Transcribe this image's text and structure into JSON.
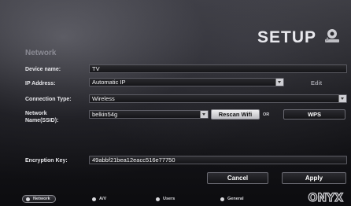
{
  "header": {
    "title": "SETUP",
    "icon": "settings-wrench-icon"
  },
  "section": {
    "title": "Network"
  },
  "form": {
    "device_name": {
      "label": "Device name:",
      "value": "TV"
    },
    "ip_address": {
      "label": "IP Address:",
      "value": "Automatic IP",
      "edit_label": "Edit"
    },
    "connection_type": {
      "label": "Connection Type:",
      "value": "Wireless"
    },
    "ssid": {
      "label": "Network\nName(SSID):",
      "value": "belkin54g",
      "rescan_label": "Rescan Wifi",
      "or_label": "OR",
      "wps_label": "WPS"
    },
    "encryption_key": {
      "label": "Encryption Key:",
      "value": "49abbf21bea12eacc516e77750"
    }
  },
  "actions": {
    "cancel_label": "Cancel",
    "apply_label": "Apply"
  },
  "tabs": [
    {
      "label": "Network",
      "icon": "network-dot-icon",
      "active": true
    },
    {
      "label": "A/V",
      "icon": "av-dot-icon",
      "active": false
    },
    {
      "label": "Users",
      "icon": "users-dot-icon",
      "active": false
    },
    {
      "label": "General",
      "icon": "general-dot-icon",
      "active": false
    }
  ],
  "brand": {
    "name": "ONYX"
  },
  "colors": {
    "background": "#1a1a1e",
    "field_bg": "#1e1e22",
    "text": "#f2f2f4",
    "muted": "#8a8a93"
  }
}
